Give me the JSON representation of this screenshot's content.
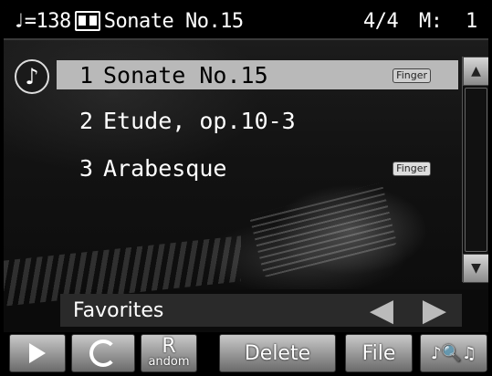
{
  "status": {
    "tempo": "=138",
    "title": "Sonate No.15",
    "beat": "4/4",
    "measure_label": "M:",
    "measure_value": "1"
  },
  "songs": [
    {
      "label": "Sonate No.15",
      "num": "1",
      "finger": "Finger"
    },
    {
      "label": "Etude, op.10-3",
      "num": "2",
      "finger": ""
    },
    {
      "label": "Arabesque",
      "num": "3",
      "finger": "Finger"
    }
  ],
  "favorites": {
    "label": "Favorites"
  },
  "buttons": {
    "random_big": "R",
    "random_small": "andom",
    "delete": "Delete",
    "file": "File",
    "search": "♪🔍♫"
  },
  "colors": {
    "selected_row": "#b9b9b9",
    "button_gradient_top": "#c9c9c9"
  }
}
